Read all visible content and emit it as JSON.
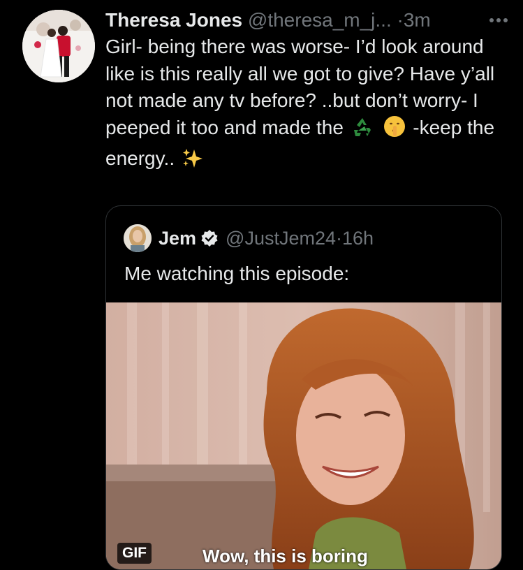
{
  "tweet": {
    "author_name": "Theresa Jones",
    "author_handle": "@theresa_m_j...",
    "dot": "·",
    "time": "3m",
    "more_icon": "more-horizontal-icon",
    "text_parts": {
      "line_main": "Girl- being there was worse- I’d look around like is this really all we got to give? Have y’all not made any tv before? ..but don’t worry- I peeped it too and made the",
      "emoji_1": "♻️",
      "emoji_2": "🤫",
      "after_emoji": "-keep the energy..",
      "emoji_3": "✨"
    }
  },
  "quote": {
    "author_name": "Jem",
    "verified_icon": "verified-badge-icon",
    "author_handle": "@JustJem24",
    "dot": "·",
    "time": "16h",
    "text": "Me watching this episode:",
    "media": {
      "badge": "GIF",
      "caption": "Wow, this is boring"
    }
  },
  "colors": {
    "background": "#000000",
    "primary_text": "#e7e9ea",
    "secondary_text": "#71767b",
    "border": "#2f3336"
  }
}
